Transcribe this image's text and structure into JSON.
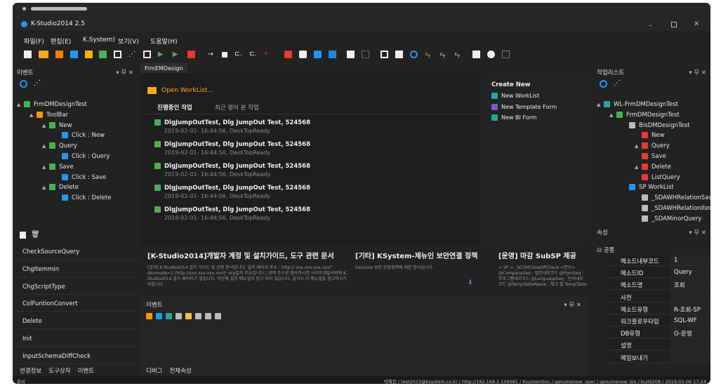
{
  "window": {
    "title": "K-Studio2014 2.5"
  },
  "menu": [
    "파일(F)",
    "편집(E)",
    "K.System)",
    "보기(V)",
    "도움말(H)"
  ],
  "events_panel": {
    "title": "이벤트",
    "tree": [
      {
        "label": "FrmDMDesignTest",
        "depth": 0,
        "icon": "form",
        "arrow": "▲"
      },
      {
        "label": "ToolBar",
        "depth": 1,
        "icon": "toolbar",
        "arrow": "▲"
      },
      {
        "label": "New",
        "depth": 2,
        "icon": "button",
        "arrow": "▲"
      },
      {
        "label": "Click : New",
        "depth": 3,
        "icon": "lightning",
        "arrow": ""
      },
      {
        "label": "Query",
        "depth": 2,
        "icon": "button",
        "arrow": "▲"
      },
      {
        "label": "Click : Query",
        "depth": 3,
        "icon": "lightning",
        "arrow": ""
      },
      {
        "label": "Save",
        "depth": 2,
        "icon": "button",
        "arrow": "▲"
      },
      {
        "label": "Click : Save",
        "depth": 3,
        "icon": "lightning",
        "arrow": ""
      },
      {
        "label": "Delete",
        "depth": 2,
        "icon": "button",
        "arrow": "▲"
      },
      {
        "label": "Click : Delete",
        "depth": 3,
        "icon": "lightning",
        "arrow": ""
      }
    ],
    "commands": [
      "CheckSourceQuery",
      "ChgItemmin",
      "ChgScriptType",
      "ColFuntionConvert",
      "Delete",
      "Init",
      "InputSchemaDiffCheck"
    ]
  },
  "left_tabs": [
    "연결정보",
    "도구상자",
    "이벤트"
  ],
  "doc_tab": "FrmEMDesign",
  "start": {
    "open_worklist": "Open WorkList...",
    "tabs": [
      "진행중인 작업",
      "최근 열어 본 작업"
    ],
    "items": [
      {
        "title": "DlgJumpOutTest, Dlg JumpOut Test, 524568",
        "sub": "2019-02-01- 16:44:56, DeskTopReady"
      },
      {
        "title": "DlgJumpOutTest, Dlg JumpOut Test, 524568",
        "sub": "2019-02-01- 16:44:56, DeskTopReady"
      },
      {
        "title": "DlgJumpOutTest, Dlg JumpOut Test, 524568",
        "sub": "2019-02-01- 16:44:56, DeskTopReady"
      },
      {
        "title": "DlgJumpOutTest, Dlg JumpOut Test, 524568",
        "sub": "2019-02-01- 16:44:56, DeskTopReady"
      },
      {
        "title": "DlgJumpOutTest, Dlg JumpOut Test, 524568",
        "sub": "2019-02-01- 16:44:56, DeskTopReady"
      }
    ],
    "create_new": {
      "title": "Create New",
      "items": [
        "New WorkList",
        "New Template Form",
        "New BI Form"
      ]
    }
  },
  "news": [
    {
      "title": "[K-Studio2014]개발자 계정 및 설치가이드, 도구 관련 문서",
      "body": "[설치] K-Studio2014 설치 가이드 및 관련 문서입니다. 설치 페이지 주소 : http:// xxx.xxx.xxx.xxx?devmode=1 (http://xxx.xxx.xxx.xxx는 erp설치 주소입니다.) 위에 주소로 접속하시면 사이트개발서버에 K-Studio2014 설치 페이지가 열립니다. 하단에 설치 메뉴얼이 링크 되어 있습니다. 설치시 이 메뉴얼을 참고하시기 바랍니다."
    },
    {
      "title": "[기타] KSystem-제뉴인 보안연결 정책",
      "body": "Genuine 보안 인증정책에 대한 문서입니다."
    },
    {
      "title": "[운영] 마감 SubSP 제공",
      "body": "< SP > _SCOMCloseSPCheck <변수> @CompanySeq : 법인내부코드 @PgmSeq : 프로그램내부코드 @LanguageSeq : 언어내부코드 @TempTableName : 체크 할 TempTable"
    }
  ],
  "bottom_events": {
    "title": "이벤트",
    "tabs": [
      "디버그",
      "전체속성"
    ]
  },
  "worklist_panel": {
    "title": "작업리스트",
    "tree": [
      {
        "label": "WL-FrmDMDesignTest",
        "depth": 0,
        "icon": "worklist",
        "arrow": "▲"
      },
      {
        "label": "FrmDMDesignTest",
        "depth": 1,
        "icon": "form",
        "arrow": "▲"
      },
      {
        "label": "BisDMDesignTest",
        "depth": 2,
        "icon": "biz",
        "arrow": ""
      },
      {
        "label": "New",
        "depth": 3,
        "icon": "method",
        "arrow": ""
      },
      {
        "label": "Query",
        "depth": 3,
        "icon": "method",
        "arrow": "▲"
      },
      {
        "label": "Save",
        "depth": 3,
        "icon": "method",
        "arrow": ""
      },
      {
        "label": "Delete",
        "depth": 3,
        "icon": "method",
        "arrow": "▲"
      },
      {
        "label": "ListQuery",
        "depth": 3,
        "icon": "method",
        "arrow": ""
      },
      {
        "label": "SP WorkList",
        "depth": 2,
        "icon": "sp",
        "arrow": ""
      },
      {
        "label": "_SDAWHRelationSave",
        "depth": 3,
        "icon": "sp-item",
        "arrow": ""
      },
      {
        "label": "_SDAWHRelationItem",
        "depth": 3,
        "icon": "sp-item",
        "arrow": ""
      },
      {
        "label": "_SDAMinorQuery",
        "depth": 3,
        "icon": "sp-item",
        "arrow": ""
      }
    ]
  },
  "properties_panel": {
    "title": "속성",
    "group": "공통",
    "rows": [
      [
        "메소드내부코드",
        "1"
      ],
      [
        "메소드ID",
        "Query"
      ],
      [
        "메소드명",
        "조회"
      ],
      [
        "사전",
        ""
      ],
      [
        "메소드유형",
        "R-조회-SP"
      ],
      [
        "워크플로우타입",
        "SQL-WF"
      ],
      [
        "DB유형",
        "O-운영"
      ],
      [
        "설명",
        ""
      ],
      [
        "메일보내기",
        ""
      ]
    ]
  },
  "status": {
    "left": "준비",
    "right": "박혜진 / test2013@ksystem.co.kr / http://192.168.2.106081 / KsystemSvc / genuinenew_oper / genuinenew_bis / build208 / 2019-03-06 17:24"
  }
}
